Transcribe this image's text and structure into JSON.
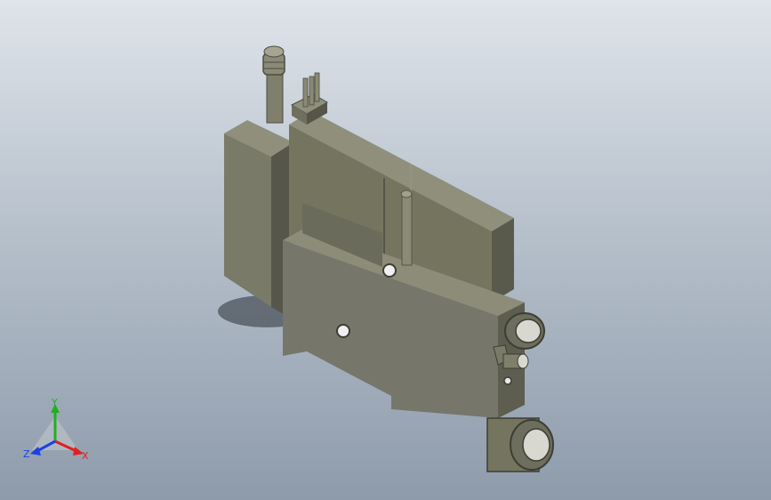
{
  "viewport": {
    "background_top": "#dfe4ea",
    "background_bottom": "#8e9bab"
  },
  "model": {
    "part_color": "#7a7a68",
    "part_light": "#8f8f7c",
    "part_dark": "#56564a"
  },
  "triad": {
    "x_label": "X",
    "y_label": "Y",
    "z_label": "Z",
    "x_color": "#e02020",
    "y_color": "#20b020",
    "z_color": "#2040e0"
  }
}
